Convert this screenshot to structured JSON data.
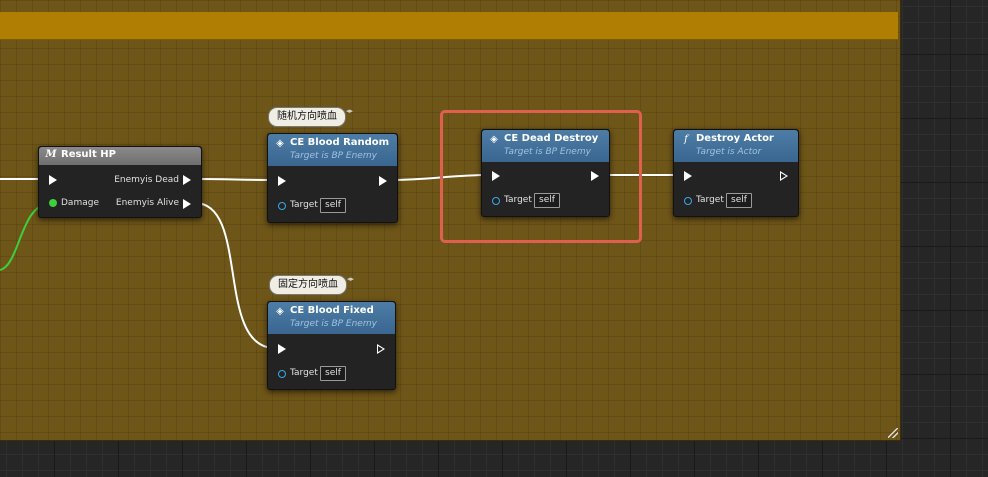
{
  "nodes": {
    "result_hp": {
      "title": "Result HP",
      "icon": "M",
      "out_dead": "Enemyis Dead",
      "out_alive": "Enemyis Alive",
      "in_damage": "Damage"
    },
    "blood_random": {
      "title": "CE Blood Random",
      "subtitle": "Target is BP Enemy",
      "bubble": "随机方向喷血",
      "target_label": "Target",
      "target_value": "self"
    },
    "blood_fixed": {
      "title": "CE Blood Fixed",
      "subtitle": "Target is BP Enemy",
      "bubble": "固定方向喷血",
      "target_label": "Target",
      "target_value": "self"
    },
    "dead_destroy": {
      "title": "CE Dead Destroy",
      "subtitle": "Target is BP Enemy",
      "target_label": "Target",
      "target_value": "self"
    },
    "destroy_actor": {
      "title": "Destroy Actor",
      "subtitle": "Target is Actor",
      "icon": "f",
      "target_label": "Target",
      "target_value": "self"
    }
  },
  "colors": {
    "comment_header": "#b07e02",
    "comment_body": "#6e5518",
    "highlight": "#e06050",
    "exec_wire": "#ffffff",
    "float_wire": "#3cd03c",
    "object_pin": "#39a8e8"
  }
}
